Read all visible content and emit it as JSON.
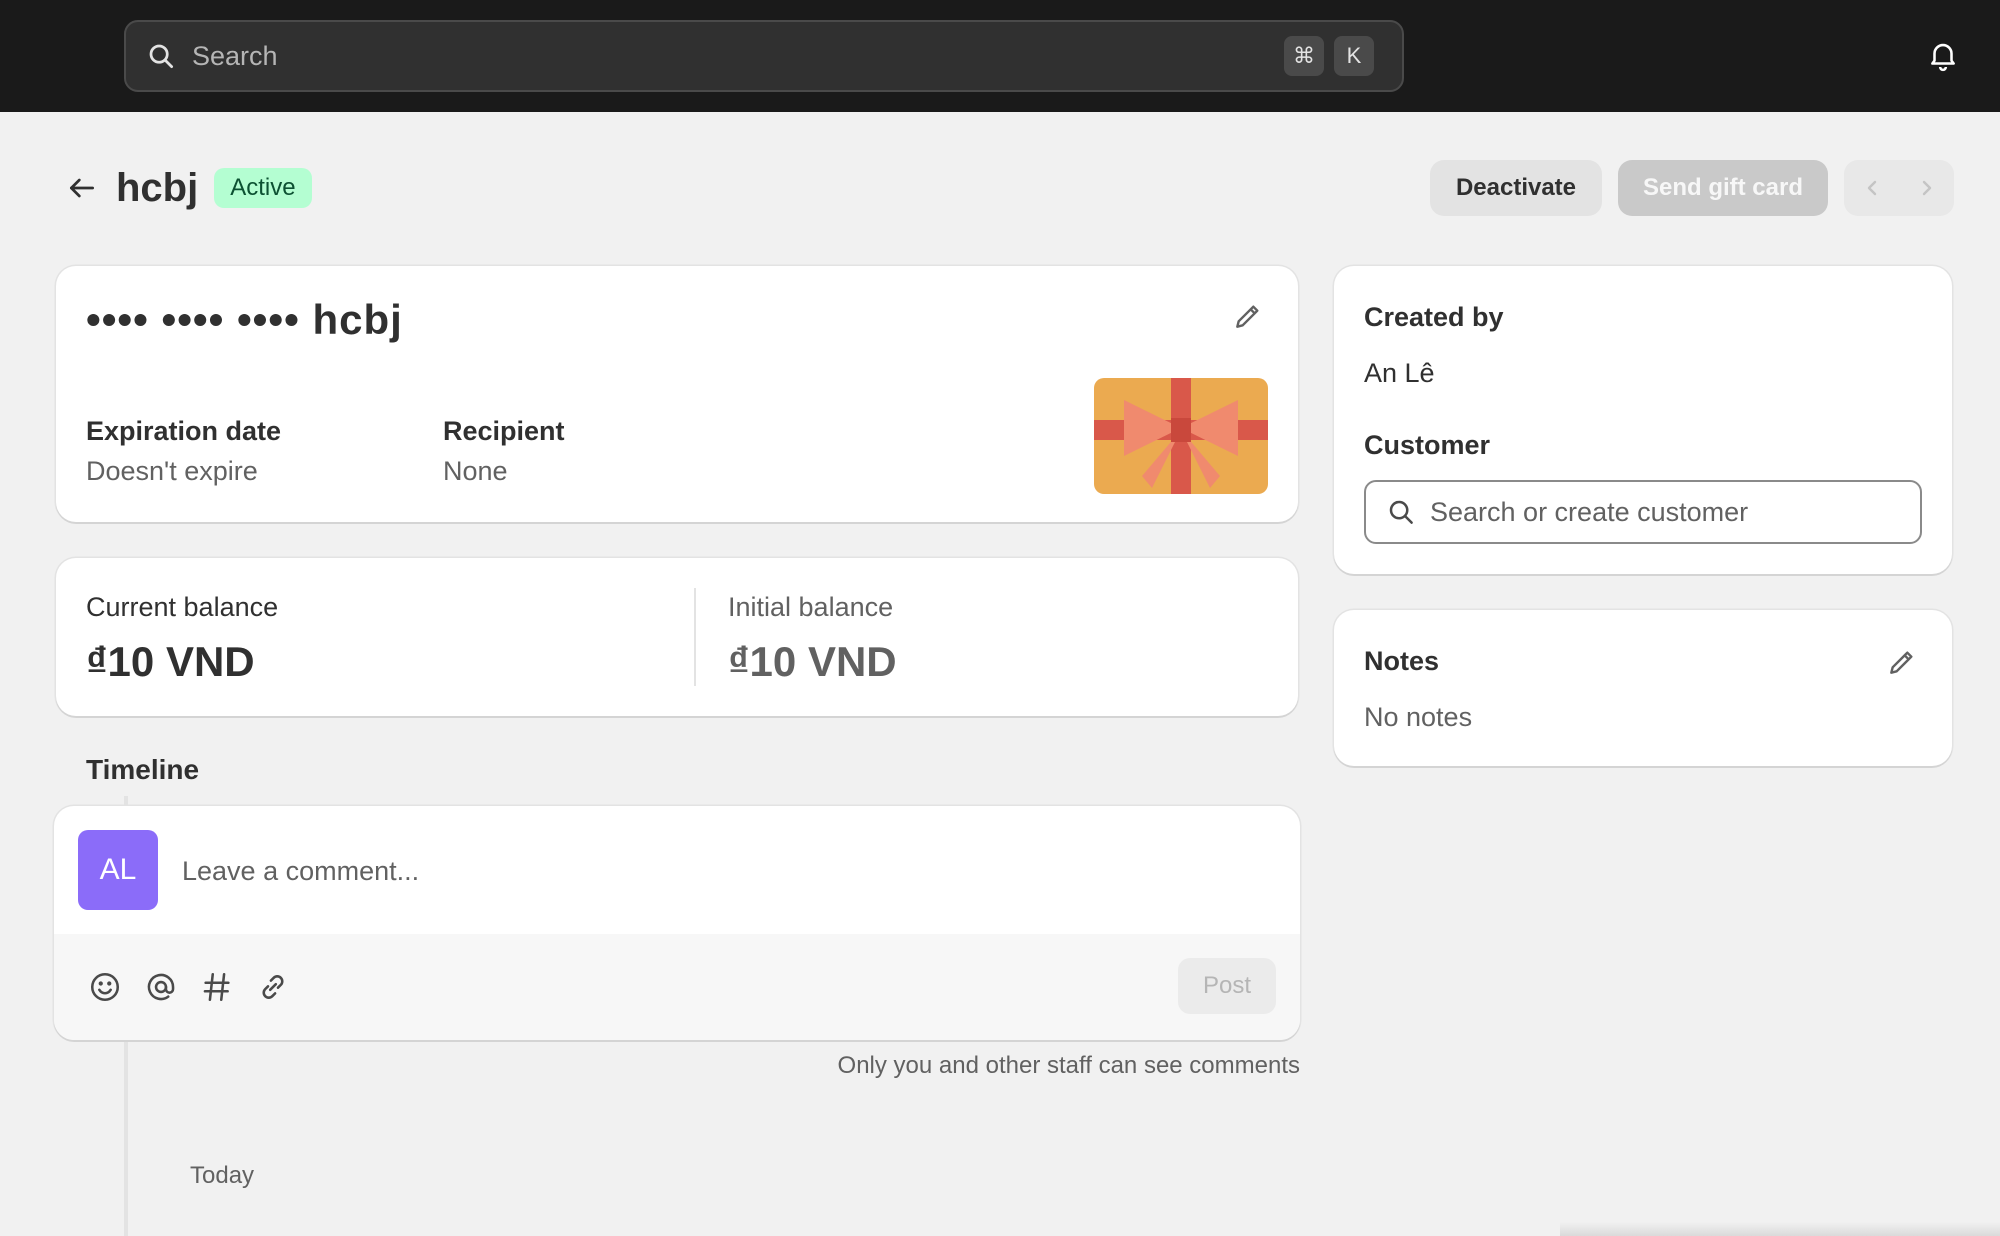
{
  "topbar": {
    "search_placeholder": "Search",
    "shortcut_keys": [
      "⌘",
      "K"
    ],
    "icons": [
      "search-icon",
      "bell-icon"
    ]
  },
  "header": {
    "title": "hcbj",
    "status": "Active",
    "actions": {
      "deactivate": "Deactivate",
      "send": "Send gift card"
    },
    "pager_icons": [
      "chevron-left-icon",
      "chevron-right-icon"
    ]
  },
  "gift_card": {
    "masked_code": "•••• •••• •••• hcbj",
    "expiration_label": "Expiration date",
    "expiration_value": "Doesn't expire",
    "recipient_label": "Recipient",
    "recipient_value": "None"
  },
  "balance": {
    "current_label": "Current balance",
    "current_value": "₫10 VND",
    "initial_label": "Initial balance",
    "initial_value": "₫10 VND"
  },
  "timeline": {
    "title": "Timeline",
    "avatar_initials": "AL",
    "comment_placeholder": "Leave a comment...",
    "post_label": "Post",
    "toolbar_icons": [
      "emoji-icon",
      "mention-icon",
      "hashtag-icon",
      "attachment-icon"
    ],
    "staff_note": "Only you and other staff can see comments",
    "day_label": "Today"
  },
  "sidebar": {
    "created_by_label": "Created by",
    "created_by_value": "An Lê",
    "customer_label": "Customer",
    "customer_placeholder": "Search or create customer",
    "notes_label": "Notes",
    "notes_value": "No notes"
  },
  "colors": {
    "topbar": "#1a1a1a",
    "page_bg": "#f1f1f1",
    "badge_bg": "#b4fed2",
    "badge_text": "#0c5132",
    "avatar": "#8b6cf9"
  }
}
